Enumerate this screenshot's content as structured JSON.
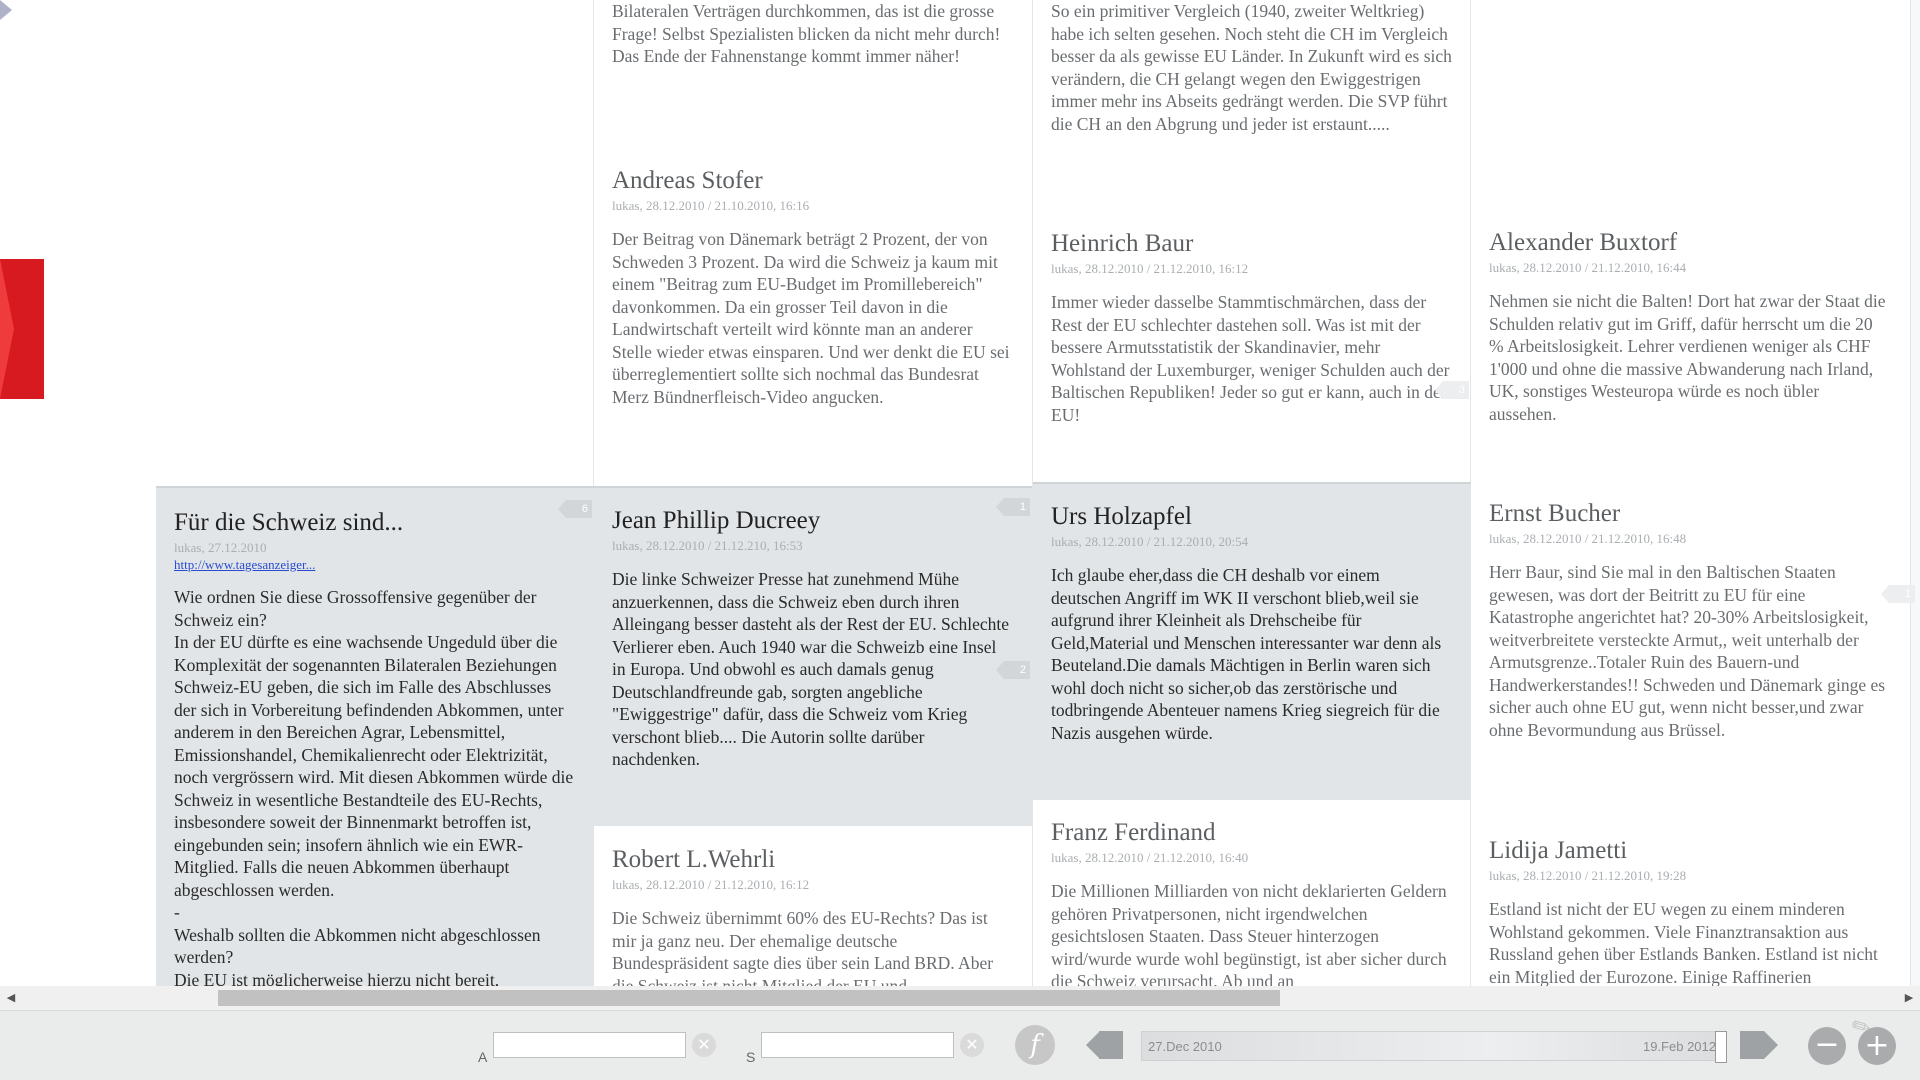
{
  "columns": {
    "col2": [
      {
        "name": "",
        "meta": "",
        "text": "Bilateralen Verträgen durchkommen, das ist die grosse Frage! Selbst Spezialisten blicken da nicht mehr durch! Das Ende der Fahnenstange kommt immer näher!"
      },
      {
        "name": "Andreas Stofer",
        "meta": "lukas, 28.12.2010 / 21.10.2010, 16:16",
        "text": "Der Beitrag von Dänemark beträgt 2 Prozent, der von Schweden 3 Prozent. Da wird die Schweiz ja kaum mit einem \"Beitrag zum EU-Budget im Promillebereich\" davonkommen. Da ein grosser Teil davon in die Landwirtschaft verteilt wird könnte man an anderer Stelle wieder etwas einsparen. Und wer denkt die EU sei überreglementiert sollte sich nochmal das Bundesrat Merz Bündnerfleisch-Video angucken."
      },
      {
        "name": "Jean Phillip Ducreey",
        "meta": "lukas, 28.12.2010 / 21.12.210, 16:53",
        "bubble": "1",
        "bubble2": "2",
        "text": "Die linke Schweizer Presse hat zunehmend Mühe anzuerkennen, dass die Schweiz eben durch ihren Alleingang besser dasteht als der Rest der EU. Schlechte Verlierer eben. Auch 1940 war die Schweizb eine Insel in Europa. Und obwohl es auch damals genug Deutschlandfreunde gab, sorgten angebliche \"Ewiggestrige\" dafür, dass die Schweiz vom Krieg verschont blieb.... Die Autorin sollte darüber nachdenken."
      },
      {
        "name": "Robert L.Wehrli",
        "meta": "lukas, 28.12.2010 / 21.12.2010, 16:12",
        "text": "Die Schweiz übernimmt 60% des EU-Rechts? Das ist mir ja ganz neu. Der ehemalige deutsche Bundespräsident sagte dies über sein Land BRD. Aber die Schweiz ist nicht Mitglied der EU und"
      }
    ],
    "col3": [
      {
        "name": "",
        "meta": "",
        "text": "So ein primitiver Vergleich (1940, zweiter Weltkrieg) habe ich selten gesehen. Noch steht die CH im Vergleich besser da als gewisse EU Länder. In Zukunft wird es sich verändern, die CH gelangt wegen den Ewiggestrigen immer mehr ins Abseits gedrängt werden. Die SVP führt die CH an den Abgrung und jeder ist erstaunt....."
      },
      {
        "name": "Heinrich Baur",
        "meta": "lukas, 28.12.2010 / 21.12.2010, 16:12",
        "bubble": "3",
        "text": "Immer wieder dasselbe Stammtischmärchen, dass der Rest der EU schlechter dastehen soll. Was ist mit der bessere Armutsstatistik der Skandinavier, mehr Wohlstand der Luxemburger, weniger Schulden auch der Baltischen Republiken! Jeder so gut er kann, auch in der EU!"
      },
      {
        "name": "Urs Holzapfel",
        "meta": "lukas, 28.12.2010 / 21.12.2010, 20:54",
        "text": "Ich glaube eher,dass die CH deshalb vor einem deutschen Angriff im WK II verschont blieb,weil sie aufgrund ihrer Kleinheit als Drehscheibe für Geld,Material und Menschen interessanter war denn als Beuteland.Die damals Mächtigen in Berlin waren sich wohl doch nicht so sicher,ob das zerstörische und todbringende Abenteuer namens Krieg siegreich für die Nazis ausgehen würde."
      },
      {
        "name": "Franz Ferdinand",
        "meta": "lukas, 28.12.2010 / 21.12.2010, 16:40",
        "text": "Die Millionen Milliarden von nicht deklarierten Geldern gehören Privatpersonen, nicht irgendwelchen gesichtslosen Staaten. Dass Steuer hinterzogen wird/wurde wurde wohl begünstigt, ist aber sicher durch die Schweiz verursacht. Ab und an"
      }
    ],
    "col4": [
      {
        "name": "Alexander Buxtorf",
        "meta": "lukas, 28.12.2010 / 21.12.2010, 16:44",
        "text": "Nehmen sie nicht die Balten! Dort hat zwar der Staat die Schulden relativ gut im Griff, dafür herrscht um die 20 % Arbeitslosigkeit. Lehrer verdienen weniger als CHF 1'000 und ohne die massive Abwanderung nach Irland, UK, sonstiges Westeuropa würde es noch übler aussehen."
      },
      {
        "name": "Ernst Bucher",
        "meta": "lukas, 28.12.2010 / 21.12.2010, 16:48",
        "bubble": "1",
        "text": "Herr Baur, sind Sie mal in den Baltischen Staaten gewesen, was dort der Beitritt zu EU für eine Katastrophe angerichtet hat? 20-30% Arbeitslosigkeit, weitverbreitete versteckte Armut,, weit unterhalb der Armutsgrenze..Totaler Ruin des Bauern-und Handwerkerstandes!! Schweden und Dänemark ginge es sicher auch ohne EU gut, wenn nicht besser,und zwar ohne Bevormundung aus Brüssel."
      },
      {
        "name": "Lidija Jametti",
        "meta": "lukas, 28.12.2010 / 21.12.2010, 19:28",
        "text": "Estland ist nicht der EU wegen zu einem minderen Wohlstand gekommen. Viele Finanztransaktion aus Russland gehen über Estlands Banken. Estland ist nicht ein Mitglied der Eurozone. Einige Raffinerien"
      }
    ],
    "col1": {
      "title": "Für die Schweiz sind...",
      "meta": "lukas, 27.12.2010",
      "link": "http://www.tagesanzeiger...",
      "bubble": "6",
      "paragraphs": [
        "Wie ordnen Sie diese Grossoffensive gegenüber der Schweiz ein?",
        "In der EU dürfte es eine wachsende Ungeduld über die Komplexität der sogenannten Bilateralen Beziehungen Schweiz-EU geben, die sich im Falle des Abschlusses der sich in Vorbereitung befindenden Abkommen, unter anderem in den Bereichen Agrar, Lebensmittel, Emissionshandel, Chemikalienrecht oder Elektrizität, noch vergrössern wird. Mit diesen Abkommen würde die Schweiz in wesentliche Bestandteile des EU-Rechts, insbesondere soweit der Binnenmarkt betroffen ist, eingebunden sein; insofern ähnlich wie ein EWR-Mitglied. Falls die neuen Abkommen überhaupt abgeschlossen werden.",
        "-",
        "Weshalb sollten die Abkommen nicht abgeschlossen werden?",
        "Die EU ist möglicherweise hierzu nicht bereit,"
      ]
    }
  },
  "scrollbar": {
    "left_arrow": "◀",
    "right_arrow": "▶"
  },
  "toolbar": {
    "label_a": "A",
    "label_s": "S",
    "input_a_value": "",
    "input_s_value": "",
    "clear_glyph": "✕",
    "facebook_glyph": "f",
    "timeline_start": "27.Dec 2010",
    "timeline_end": "19.Feb 2012",
    "zoom_out_glyph": "−",
    "zoom_in_glyph": "+",
    "tools_glyph": "✎"
  },
  "colors": {
    "accent_red": "#d71920",
    "grey_card": "#e1e5e7",
    "toolbar_bg": "#eaebeb"
  },
  "icons": {
    "left_top": "left-arrow-icon",
    "side_tab": "chevron-right-icon",
    "facebook": "facebook-icon",
    "zoom_out": "minus-icon",
    "zoom_in": "plus-icon",
    "tools": "pencil-icon"
  }
}
